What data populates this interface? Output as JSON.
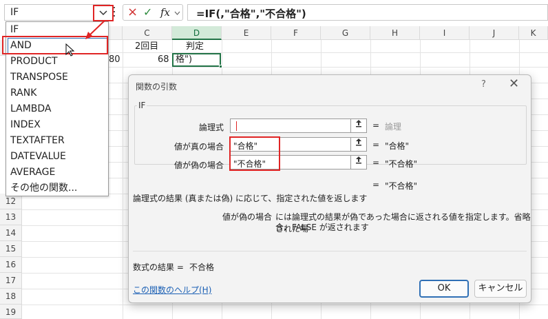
{
  "namebox": {
    "value": "IF"
  },
  "formula_bar": {
    "text": "=IF(,\"合格\",\"不合格\")",
    "cancel_icon": "×",
    "enter_icon": "✓",
    "fx_label": "fx"
  },
  "columns": [
    "C",
    "D",
    "E",
    "F",
    "G",
    "H",
    "I",
    "J",
    "K"
  ],
  "rows": [
    "12",
    "13",
    "14",
    "15",
    "16",
    "17",
    "18",
    "19",
    "20",
    "21"
  ],
  "cells": {
    "c1": "2回目",
    "d1": "判定",
    "b2": "80",
    "c2": "68",
    "d2": "格\")"
  },
  "dropdown": {
    "items": [
      "IF",
      "AND",
      "PRODUCT",
      "TRANSPOSE",
      "RANK",
      "LAMBDA",
      "INDEX",
      "TEXTAFTER",
      "DATEVALUE",
      "AVERAGE",
      "その他の関数..."
    ]
  },
  "dialog": {
    "title": "関数の引数",
    "help_symbol": "?",
    "close_symbol": "✕",
    "function_name": "IF",
    "args": [
      {
        "label": "論理式",
        "value": "",
        "result": "論理"
      },
      {
        "label": "値が真の場合",
        "value": "\"合格\"",
        "result": "\"合格\""
      },
      {
        "label": "値が偽の場合",
        "value": "\"不合格\"",
        "result": "\"不合格\""
      }
    ],
    "equals": "=",
    "overall_result": "\"不合格\"",
    "description": "論理式の結果 (真または偽) に応じて、指定された値を返します",
    "arg_desc_label": "値が偽の場合",
    "arg_desc_line1": "には論理式の結果が偽であった場合に返される値を指定します。省略された場",
    "arg_desc_line2": "合、FALSE が返されます",
    "formula_result_label": "数式の結果 =",
    "formula_result_value": "不合格",
    "help_link": "この関数のヘルプ(H)",
    "ok": "OK",
    "cancel": "キャンセル"
  }
}
